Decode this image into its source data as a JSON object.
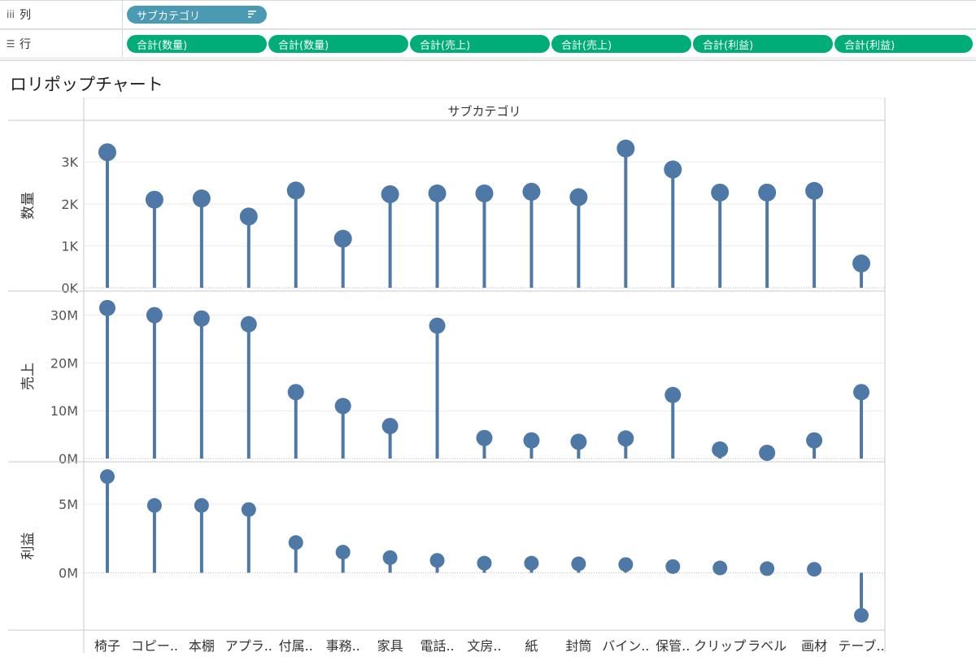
{
  "shelves": {
    "columns": {
      "icon": "iii",
      "label": "列",
      "pills": [
        {
          "text": "サブカテゴリ",
          "icon": "sort-icon"
        }
      ]
    },
    "rows": {
      "icon": "☰",
      "label": "行",
      "pills": [
        "合計(数量)",
        "合計(数量)",
        "合計(売上)",
        "合計(売上)",
        "合計(利益)",
        "合計(利益)"
      ]
    }
  },
  "sheet_title": "ロリポップチャート",
  "colors": {
    "mark": "#4e79a7",
    "column_pill": "#4a9ab3",
    "row_pill": "#00ad78"
  },
  "chart_data": {
    "type": "lollipop",
    "column_header": "サブカテゴリ",
    "categories": [
      "椅子",
      "コピー..",
      "本棚",
      "アプラ..",
      "付属..",
      "事務..",
      "家具",
      "電話..",
      "文房..",
      "紙",
      "封筒",
      "バイン..",
      "保管..",
      "クリップ",
      "ラベル",
      "画材",
      "テーブ.."
    ],
    "panes": [
      {
        "name": "数量",
        "ticks": [
          "0K",
          "1K",
          "2K",
          "3K"
        ],
        "tick_values": [
          0,
          1000,
          2000,
          3000
        ],
        "ylim": [
          0,
          3700
        ],
        "values": [
          3230,
          2100,
          2130,
          1700,
          2320,
          1170,
          2230,
          2250,
          2250,
          2290,
          2160,
          3320,
          2820,
          2270,
          2270,
          2310,
          580
        ]
      },
      {
        "name": "売上",
        "ticks": [
          "0M",
          "10M",
          "20M",
          "30M"
        ],
        "tick_values": [
          0,
          10000000,
          20000000,
          30000000
        ],
        "ylim": [
          0,
          33000000
        ],
        "values": [
          31500000,
          30000000,
          29300000,
          28100000,
          13900000,
          11000000,
          6800000,
          27800000,
          4300000,
          3800000,
          3500000,
          4200000,
          13300000,
          1900000,
          1200000,
          3800000,
          13900000
        ]
      },
      {
        "name": "利益",
        "ticks": [
          "0M",
          "5M"
        ],
        "tick_values": [
          0,
          5000000
        ],
        "ylim": [
          -3700000,
          7600000
        ],
        "values": [
          7000000,
          4900000,
          4900000,
          4600000,
          2200000,
          1500000,
          1100000,
          900000,
          700000,
          700000,
          650000,
          600000,
          450000,
          350000,
          300000,
          250000,
          -3100000
        ]
      }
    ]
  }
}
